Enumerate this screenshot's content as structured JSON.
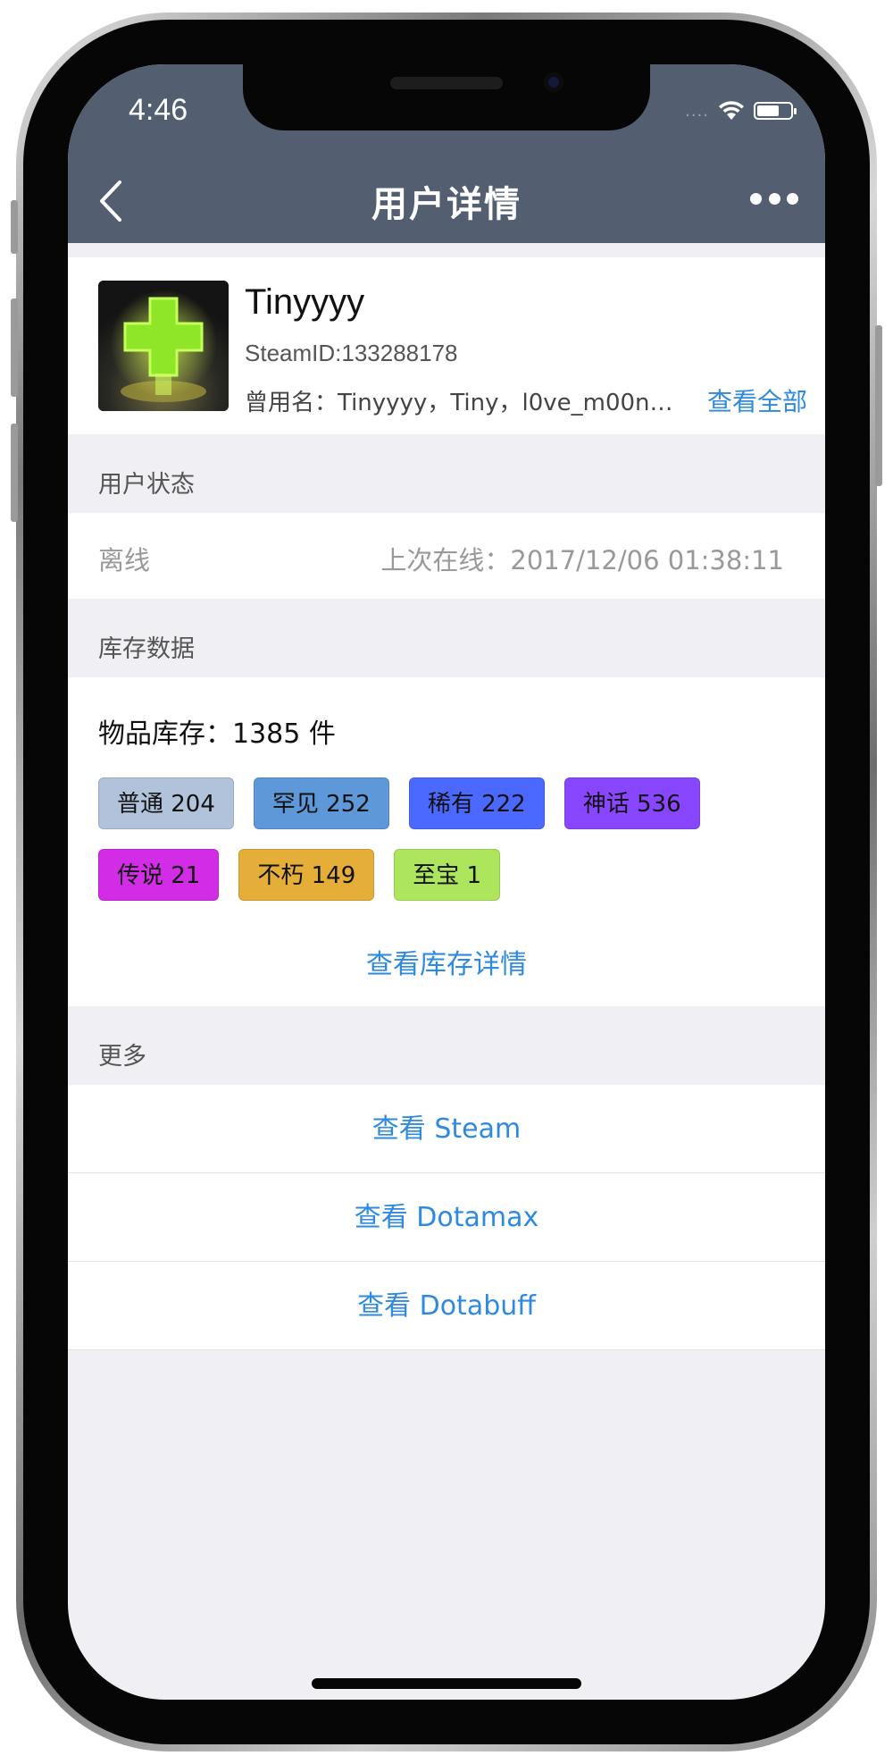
{
  "status_bar": {
    "time": "4:46",
    "signal": "....",
    "wifi_icon": "wifi-icon",
    "battery_icon": "battery-icon"
  },
  "navbar": {
    "title": "用户详情",
    "back_icon": "chevron-left-icon",
    "more_icon": "more-dots-icon",
    "color": "#535f70"
  },
  "profile": {
    "username": "Tinyyyy",
    "steam_id": "SteamID:133288178",
    "aliases": "曾用名：Tinyyyy，Tiny，l0ve_m00n…",
    "view_all": "查看全部"
  },
  "user_status": {
    "header": "用户状态",
    "state": "离线",
    "last_online": "上次在线：2017/12/06 01:38:11"
  },
  "inventory": {
    "header": "库存数据",
    "count": "物品库存：1385 件",
    "tags": [
      {
        "label": "普通 204",
        "color": "#b0c3db"
      },
      {
        "label": "罕见 252",
        "color": "#5e98d9"
      },
      {
        "label": "稀有 222",
        "color": "#4b69ff"
      },
      {
        "label": "神话 536",
        "color": "#8847ff"
      },
      {
        "label": "传说 21",
        "color": "#d32ce6"
      },
      {
        "label": "不朽 149",
        "color": "#e4ae39"
      },
      {
        "label": "至宝 1",
        "color": "#ade55c"
      }
    ],
    "detail_link": "查看库存详情"
  },
  "more": {
    "header": "更多",
    "links": [
      "查看 Steam",
      "查看 Dotamax",
      "查看 Dotabuff"
    ]
  },
  "accent_color": "#2d8ae0"
}
